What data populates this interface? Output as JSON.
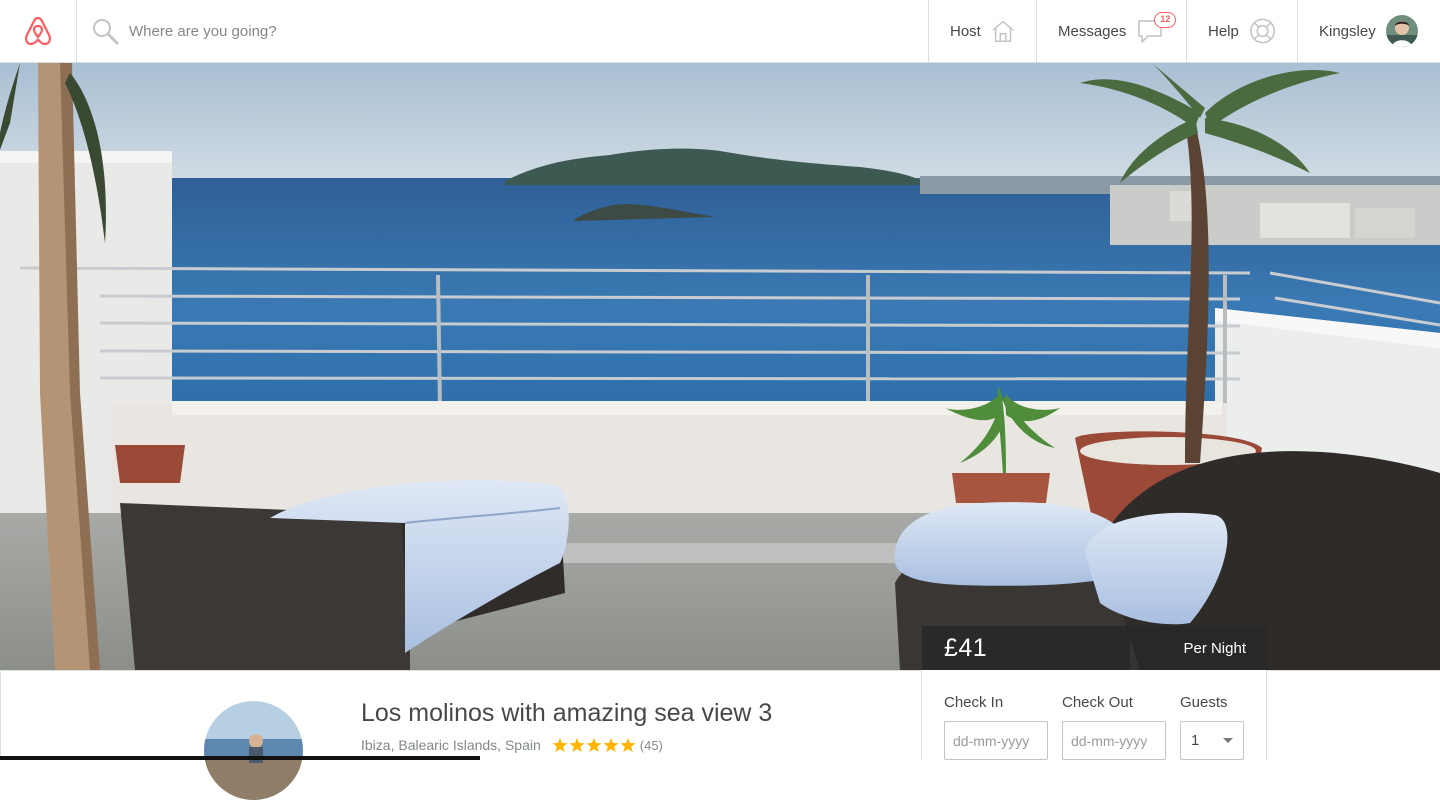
{
  "nav": {
    "brand_icon": "airbnb-belo-icon",
    "search": {
      "placeholder": "Where are you going?",
      "icon": "search-icon"
    },
    "host": {
      "label": "Host",
      "icon": "home-icon"
    },
    "messages": {
      "label": "Messages",
      "icon": "chat-bubble-icon",
      "badge": "12"
    },
    "help": {
      "label": "Help",
      "icon": "lifebuoy-icon"
    },
    "user": {
      "label": "Kingsley",
      "icon": "user-avatar"
    }
  },
  "hero": {
    "price": "£41",
    "price_unit": "Per Night"
  },
  "listing": {
    "title": "Los molinos with amazing sea view 3",
    "location": "Ibiza, Balearic Islands, Spain",
    "rating_stars": 5,
    "reviews": "(45)"
  },
  "booking": {
    "check_in_label": "Check In",
    "check_out_label": "Check Out",
    "guests_label": "Guests",
    "check_in_placeholder": "dd-mm-yyyy",
    "check_out_placeholder": "dd-mm-yyyy",
    "guests_value": "1"
  },
  "colors": {
    "brand": "#ff5a5f",
    "text": "#484848",
    "muted": "#82888a",
    "star": "#ffb400",
    "border": "#dce0e0"
  }
}
